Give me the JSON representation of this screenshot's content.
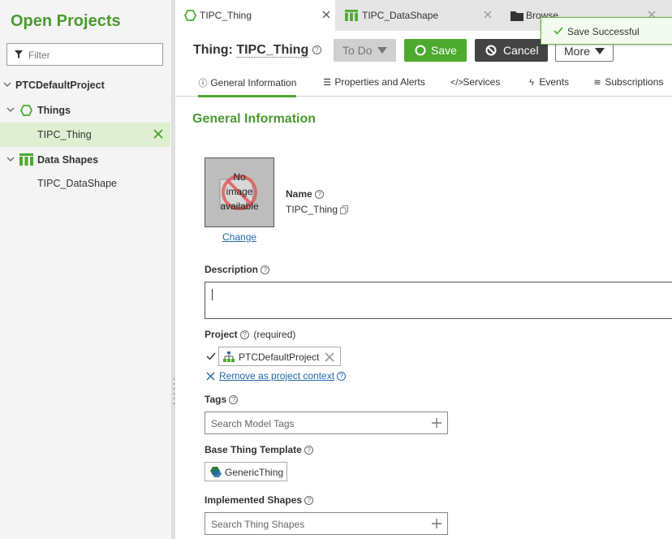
{
  "sidebar": {
    "title": "Open Projects",
    "filter_placeholder": "Filter",
    "tree": {
      "project": "PTCDefaultProject",
      "things_group": "Things",
      "thing_item": "TIPC_Thing",
      "datashapes_group": "Data Shapes",
      "datashape_item": "TIPC_DataShape"
    }
  },
  "tabs": [
    {
      "label": "TIPC_Thing",
      "icon": "thing-icon",
      "active": true
    },
    {
      "label": "TIPC_DataShape",
      "icon": "datashape-icon",
      "active": false
    },
    {
      "label": "Browse",
      "icon": "folder-icon",
      "active": false
    }
  ],
  "toast": {
    "message": "Save Successful",
    "color": "#66b045"
  },
  "header": {
    "prefix": "Thing:",
    "name": "TIPC_Thing",
    "todo_label": "To Do",
    "save_label": "Save",
    "cancel_label": "Cancel",
    "more_label": "More"
  },
  "subtabs": [
    {
      "label": "General Information",
      "icon": "info-icon"
    },
    {
      "label": "Properties and Alerts",
      "icon": "list-icon"
    },
    {
      "label": "Services",
      "icon": "code-icon"
    },
    {
      "label": "Events",
      "icon": "bolt-icon"
    },
    {
      "label": "Subscriptions",
      "icon": "rss-icon"
    }
  ],
  "general": {
    "section_title": "General Information",
    "no_image_line1": "No",
    "no_image_line2": "image",
    "no_image_line3": "available",
    "change_label": "Change",
    "name_label": "Name",
    "name_value": "TIPC_Thing",
    "description_label": "Description",
    "description_value": "",
    "project_label": "Project",
    "project_required": "(required)",
    "project_value": "PTCDefaultProject",
    "remove_context_label": "Remove as project context",
    "tags_label": "Tags",
    "tags_placeholder": "Search Model Tags",
    "base_template_label": "Base Thing Template",
    "base_template_value": "GenericThing",
    "implemented_shapes_label": "Implemented Shapes",
    "shapes_placeholder": "Search Thing Shapes"
  },
  "colors": {
    "accent": "#4caa2e",
    "heading": "#4a9b2f",
    "link": "#2367a8"
  }
}
